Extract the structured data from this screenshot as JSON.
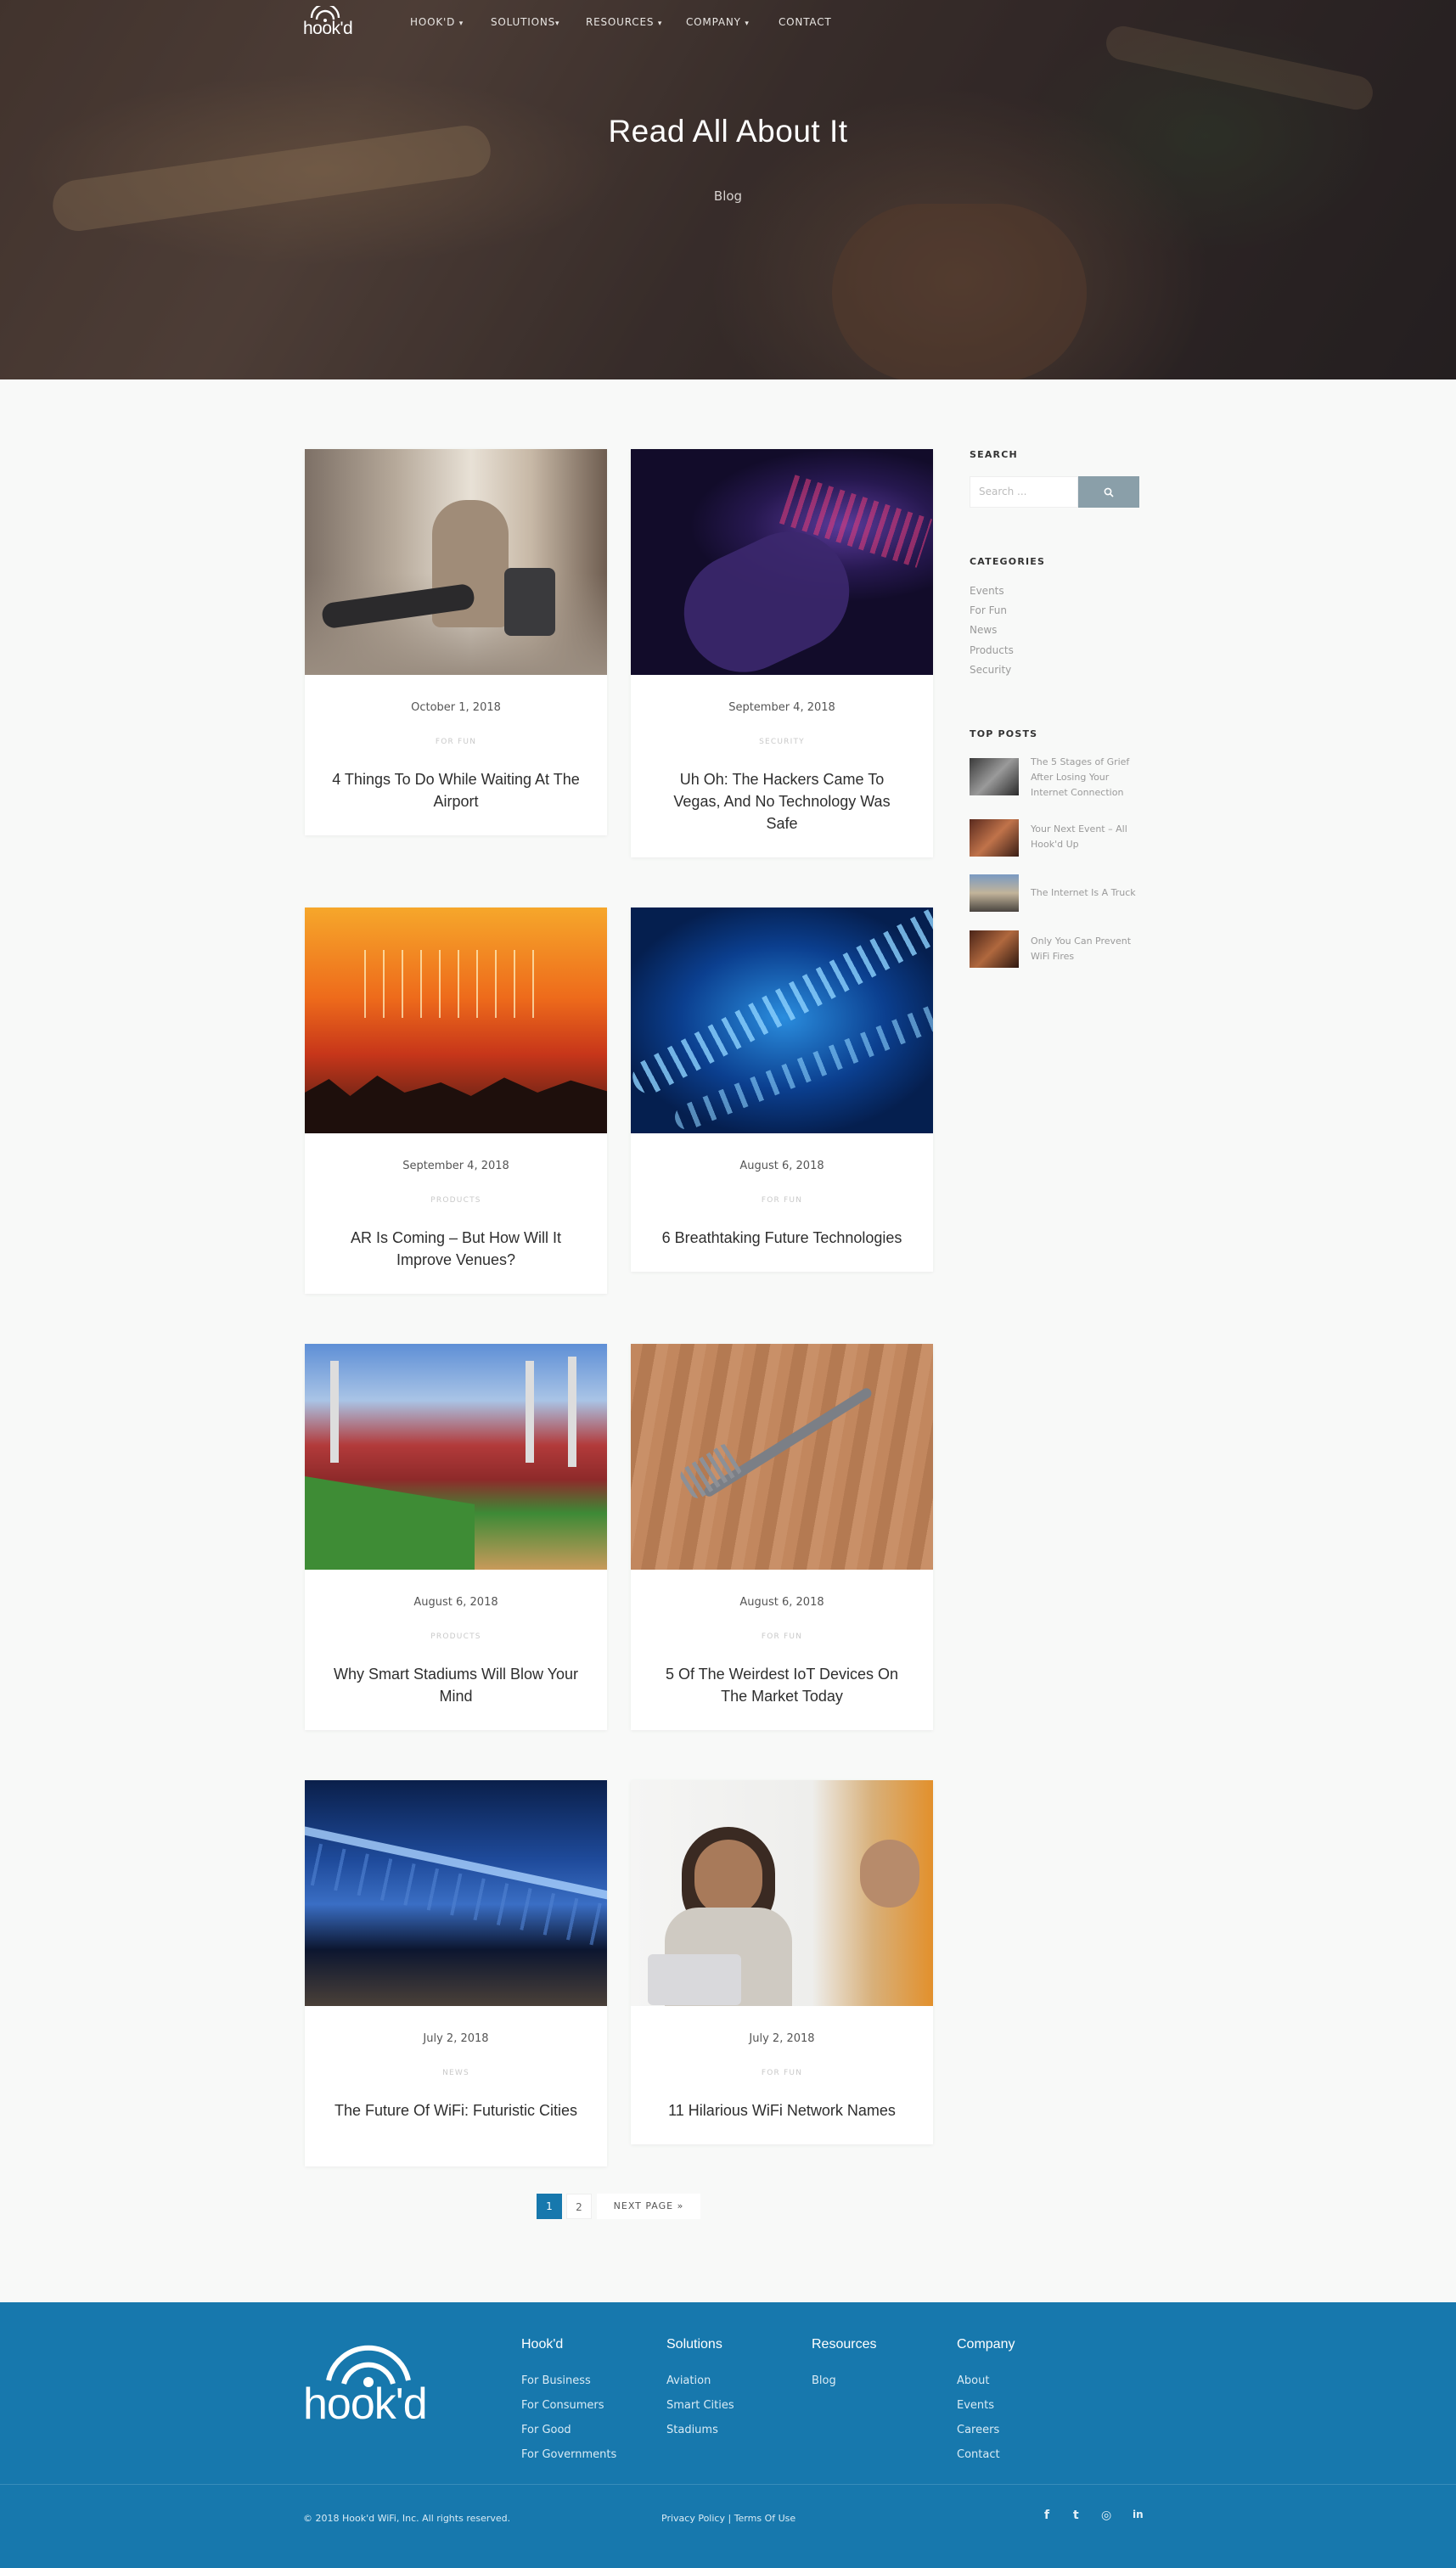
{
  "nav": {
    "logo_text": "hook'd",
    "items": [
      "HOOK'D",
      "SOLUTIONS",
      "RESOURCES",
      "COMPANY",
      "CONTACT"
    ],
    "caret": "▾"
  },
  "hero": {
    "title": "Read All About It",
    "subtitle": "Blog"
  },
  "posts": [
    {
      "date": "October 1, 2018",
      "category": "FOR FUN",
      "title": "4 Things To Do While Waiting At The Airport"
    },
    {
      "date": "September 4, 2018",
      "category": "SECURITY",
      "title": "Uh Oh: The Hackers Came To Vegas, And No Technology Was Safe"
    },
    {
      "date": "September 4, 2018",
      "category": "PRODUCTS",
      "title": "AR Is Coming – But How Will It Improve Venues?"
    },
    {
      "date": "August 6, 2018",
      "category": "FOR FUN",
      "title": "6 Breathtaking Future Technologies"
    },
    {
      "date": "August 6, 2018",
      "category": "PRODUCTS",
      "title": "Why Smart Stadiums Will Blow Your Mind"
    },
    {
      "date": "August 6, 2018",
      "category": "FOR FUN",
      "title": "5 Of The Weirdest IoT Devices On The Market Today"
    },
    {
      "date": "July 2, 2018",
      "category": "NEWS",
      "title": "The Future Of WiFi: Futuristic Cities"
    },
    {
      "date": "July 2, 2018",
      "category": "FOR FUN",
      "title": "11 Hilarious WiFi Network Names"
    }
  ],
  "sidebar": {
    "search_heading": "SEARCH",
    "search_placeholder": "Search ...",
    "categories_heading": "CATEGORIES",
    "categories": [
      "Events",
      "For Fun",
      "News",
      "Products",
      "Security"
    ],
    "top_posts_heading": "TOP POSTS",
    "top_posts": [
      "The 5 Stages of Grief After Losing Your Internet Connection",
      "Your Next Event – All Hook'd Up",
      "The Internet Is A Truck",
      "Only You Can Prevent WiFi Fires"
    ]
  },
  "pagination": {
    "pages": [
      "1",
      "2"
    ],
    "next_label": "NEXT PAGE »"
  },
  "footer": {
    "logo_text": "hook'd",
    "columns": [
      {
        "heading": "Hook'd",
        "links": [
          "For Business",
          "For Consumers",
          "For Good",
          "For Governments"
        ]
      },
      {
        "heading": "Solutions",
        "links": [
          "Aviation",
          "Smart Cities",
          "Stadiums"
        ]
      },
      {
        "heading": "Resources",
        "links": [
          "Blog"
        ]
      },
      {
        "heading": "Company",
        "links": [
          "About",
          "Events",
          "Careers",
          "Contact"
        ]
      }
    ],
    "copyright": "© 2018 Hook'd WiFi, Inc. All rights reserved.",
    "privacy": "Privacy Policy",
    "separator": "|",
    "terms": "Terms Of Use",
    "social": [
      "f",
      "t",
      "◎",
      "in"
    ]
  },
  "colors": {
    "brand_blue": "#1778ad",
    "search_button": "#8a9fa9",
    "active_page": "#1778ad"
  }
}
